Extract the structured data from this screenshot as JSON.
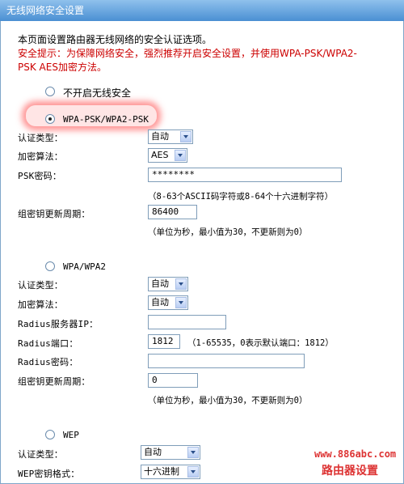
{
  "window": {
    "title": "无线网络安全设置"
  },
  "intro": {
    "line1": "本页面设置路由器无线网络的安全认证选项。",
    "warn1": "安全提示：为保障网络安全，强烈推荐开启安全设置，并使用WPA-PSK/WPA2-",
    "warn2": "PSK AES加密方法。"
  },
  "options": {
    "none": "不开启无线安全",
    "wpapsk": "WPA-PSK/WPA2-PSK",
    "wpa": "WPA/WPA2",
    "wep": "WEP"
  },
  "wpapsk": {
    "auth_label": "认证类型：",
    "auth_value": "自动",
    "enc_label": "加密算法：",
    "enc_value": "AES",
    "psk_label": "PSK密码：",
    "psk_value": "********",
    "psk_hint": "（8-63个ASCII码字符或8-64个十六进制字符）",
    "period_label": "组密钥更新周期：",
    "period_value": "86400",
    "period_hint": "（单位为秒，最小值为30，不更新则为0）"
  },
  "wpa": {
    "auth_label": "认证类型：",
    "auth_value": "自动",
    "enc_label": "加密算法：",
    "enc_value": "自动",
    "server_label": "Radius服务器IP：",
    "server_value": "",
    "port_label": "Radius端口：",
    "port_value": "1812",
    "port_hint": "（1-65535，0表示默认端口：1812）",
    "pwd_label": "Radius密码：",
    "pwd_value": "",
    "period_label": "组密钥更新周期：",
    "period_value": "0",
    "period_hint": "（单位为秒，最小值为30，不更新则为0）"
  },
  "wep": {
    "auth_label": "认证类型：",
    "auth_value": "自动",
    "format_label": "WEP密钥格式：",
    "format_value": "十六进制"
  },
  "watermark": {
    "url": "www.886abc.com",
    "text": "路由器设置"
  }
}
